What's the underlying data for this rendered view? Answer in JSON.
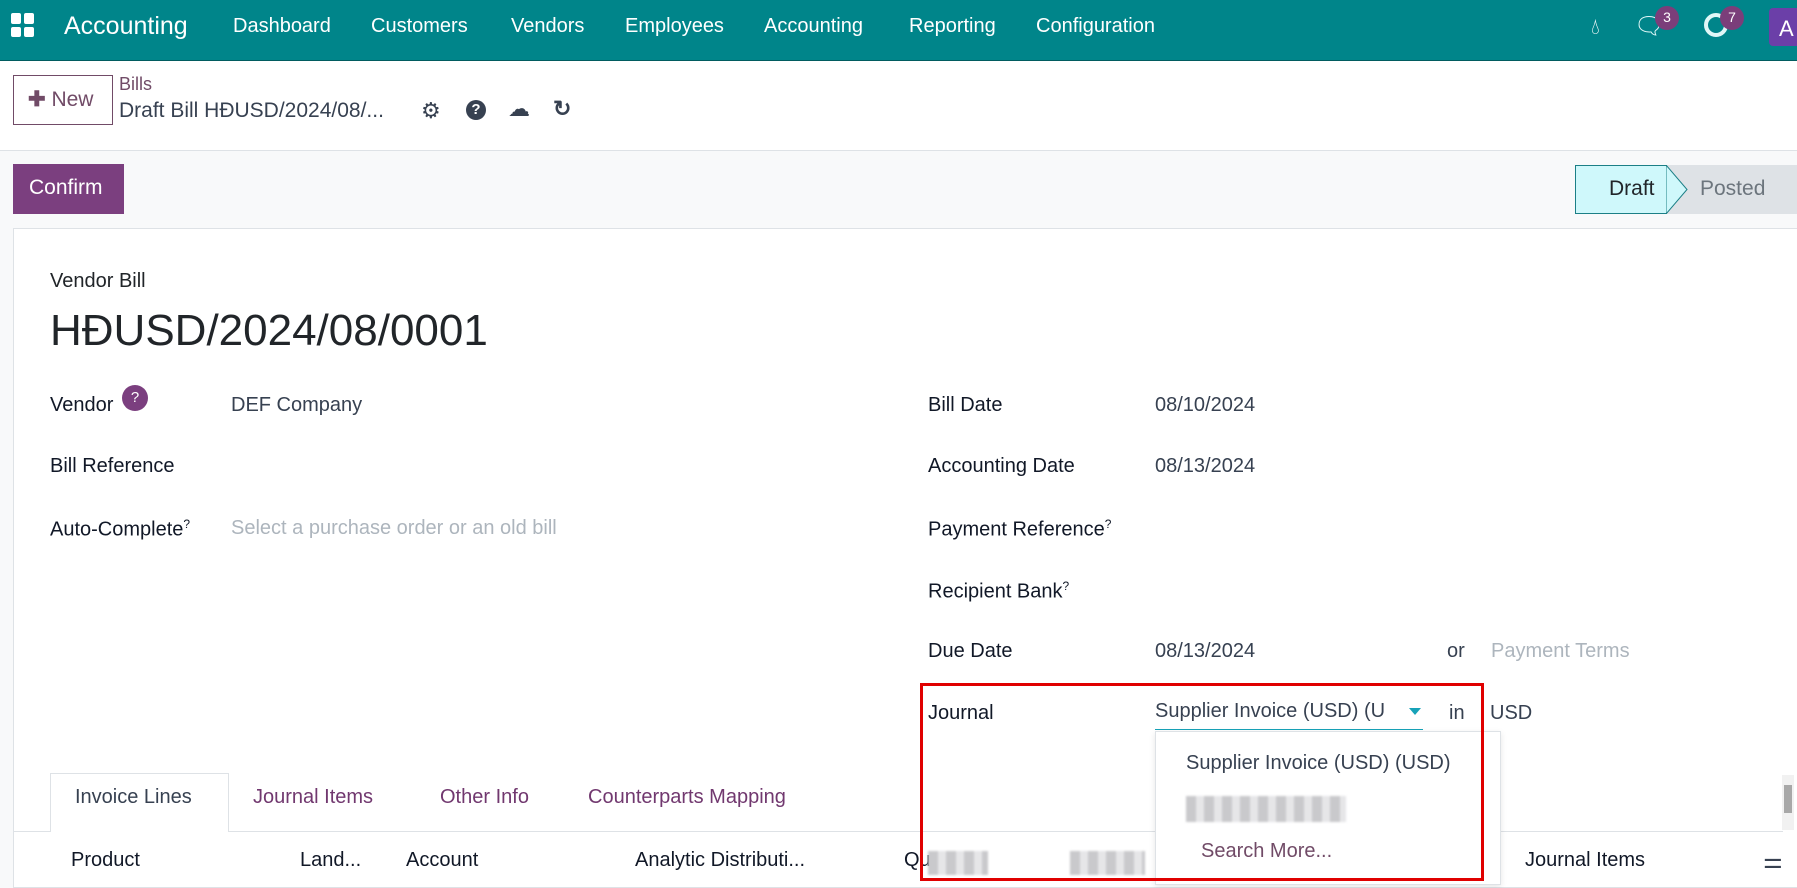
{
  "navbar": {
    "app_name": "Accounting",
    "menu": [
      "Dashboard",
      "Customers",
      "Vendors",
      "Employees",
      "Accounting",
      "Reporting",
      "Configuration"
    ],
    "messages_count": "3",
    "activities_count": "7",
    "avatar": "A",
    "icons": [
      "apps-grid-icon",
      "drop-icon",
      "chat-icon",
      "clock-icon"
    ]
  },
  "control_panel": {
    "new_label": "New",
    "breadcrumb_parent": "Bills",
    "breadcrumb_current": "Draft Bill HĐUSD/2024/08/...",
    "icons": [
      "gear-icon",
      "help-icon",
      "cloud-upload-icon",
      "undo-icon"
    ]
  },
  "status_bar": {
    "confirm_label": "Confirm",
    "stages": [
      "Draft",
      "Posted"
    ],
    "active_stage": "Draft"
  },
  "form": {
    "doc_type": "Vendor Bill",
    "number": "HĐUSD/2024/08/0001",
    "vendor_label": "Vendor",
    "vendor_help": "?",
    "vendor_value": "DEF Company",
    "bill_reference_label": "Bill Reference",
    "auto_complete_label": "Auto-Complete",
    "auto_complete_placeholder": "Select a purchase order or an old bill",
    "bill_date_label": "Bill Date",
    "bill_date": "08/10/2024",
    "accounting_date_label": "Accounting Date",
    "accounting_date": "08/13/2024",
    "payment_reference_label": "Payment Reference",
    "recipient_bank_label": "Recipient Bank",
    "due_date_label": "Due Date",
    "due_date": "08/13/2024",
    "or_label": "or",
    "payment_terms_placeholder": "Payment Terms",
    "journal_label": "Journal",
    "journal_value": "Supplier Invoice (USD) (U",
    "in_label": "in",
    "currency": "USD",
    "help_mark": "?"
  },
  "journal_dropdown": {
    "options": [
      "Supplier Invoice (USD) (USD)"
    ],
    "search_more": "Search More..."
  },
  "tabs": [
    "Invoice Lines",
    "Journal Items",
    "Other Info",
    "Counterparts Mapping"
  ],
  "active_tab": "Invoice Lines",
  "table": {
    "columns": [
      "Product",
      "Land...",
      "Account",
      "Analytic Distributi...",
      "Qu",
      "Journal Items"
    ]
  },
  "colors": {
    "navbar": "#00858a",
    "brand": "#714b67",
    "highlight": "#e00000"
  }
}
